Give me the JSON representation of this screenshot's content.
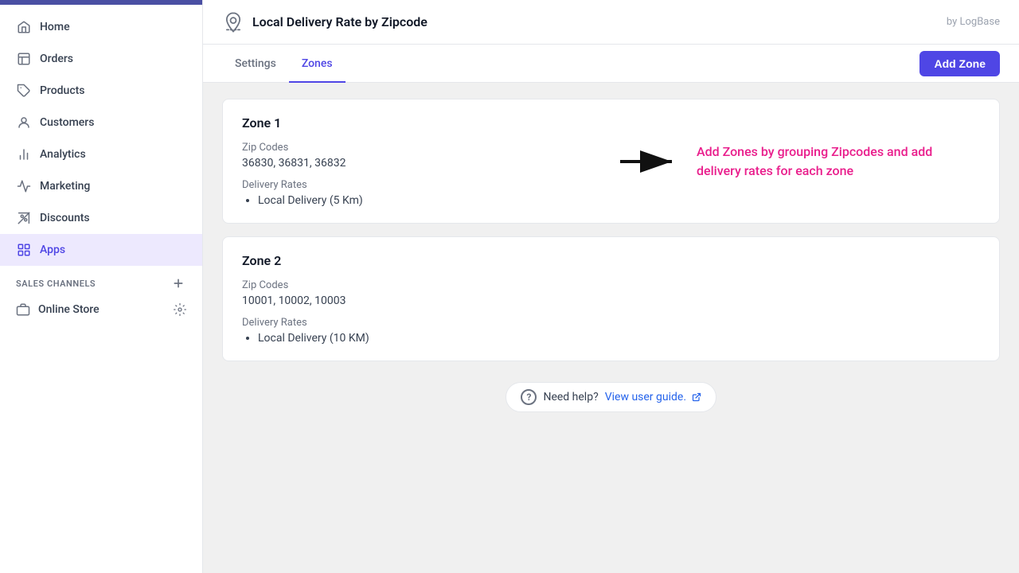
{
  "sidebar": {
    "items": [
      {
        "id": "home",
        "label": "Home",
        "icon": "home-icon"
      },
      {
        "id": "orders",
        "label": "Orders",
        "icon": "orders-icon"
      },
      {
        "id": "products",
        "label": "Products",
        "icon": "products-icon"
      },
      {
        "id": "customers",
        "label": "Customers",
        "icon": "customers-icon"
      },
      {
        "id": "analytics",
        "label": "Analytics",
        "icon": "analytics-icon"
      },
      {
        "id": "marketing",
        "label": "Marketing",
        "icon": "marketing-icon"
      },
      {
        "id": "discounts",
        "label": "Discounts",
        "icon": "discounts-icon"
      },
      {
        "id": "apps",
        "label": "Apps",
        "icon": "apps-icon",
        "active": true
      }
    ],
    "sales_channels_label": "SALES CHANNELS",
    "online_store_label": "Online Store"
  },
  "header": {
    "app_icon_alt": "delivery-app-icon",
    "title": "Local Delivery Rate by Zipcode",
    "by_label": "by LogBase"
  },
  "tabs": [
    {
      "id": "settings",
      "label": "Settings",
      "active": false
    },
    {
      "id": "zones",
      "label": "Zones",
      "active": true
    }
  ],
  "add_zone_button": "Add Zone",
  "zones": [
    {
      "id": "zone1",
      "title": "Zone 1",
      "zip_codes_label": "Zip Codes",
      "zip_codes_value": "36830, 36831, 36832",
      "delivery_rates_label": "Delivery Rates",
      "delivery_rates": [
        "Local Delivery (5 Km)"
      ]
    },
    {
      "id": "zone2",
      "title": "Zone 2",
      "zip_codes_label": "Zip Codes",
      "zip_codes_value": "10001, 10002, 10003",
      "delivery_rates_label": "Delivery Rates",
      "delivery_rates": [
        "Local Delivery (10 KM)"
      ]
    }
  ],
  "tooltip": {
    "text": "Add Zones by grouping Zipcodes and add delivery rates for each zone"
  },
  "help": {
    "text": "Need help?",
    "link_label": "View user guide.",
    "link_icon": "external-link-icon"
  },
  "colors": {
    "accent": "#4f46e5",
    "tooltip_text": "#e91e8c",
    "active_bg": "#ede9fe"
  }
}
